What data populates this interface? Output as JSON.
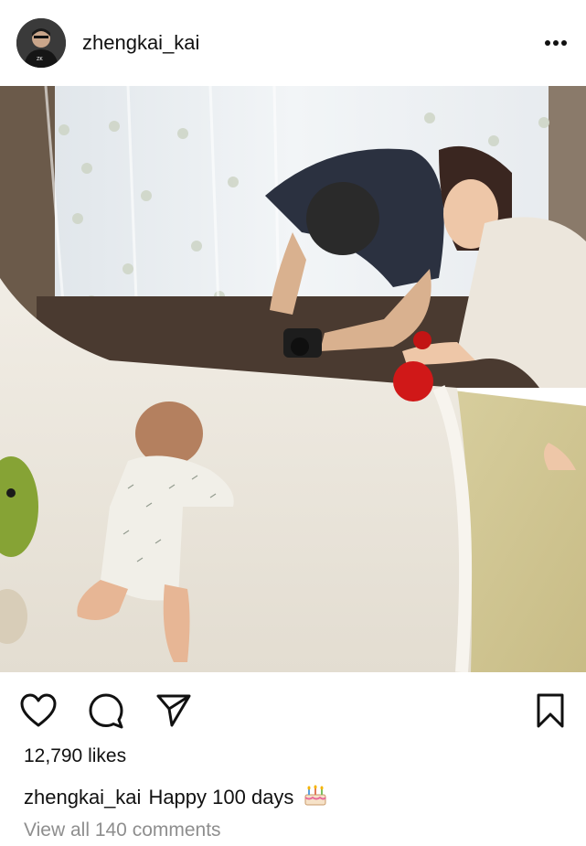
{
  "post": {
    "username": "zhengkai_kai",
    "more_icon": "more-horizontal-icon",
    "likes_text": "12,790 likes",
    "caption_username": "zhengkai_kai",
    "caption_text": "Happy 100 days",
    "caption_emoji": "birthday-cake-icon",
    "view_comments": "View all 140 comments"
  },
  "actions": [
    {
      "name": "like-button",
      "icon": "heart-icon"
    },
    {
      "name": "comment-button",
      "icon": "comment-icon"
    },
    {
      "name": "share-button",
      "icon": "send-icon"
    },
    {
      "name": "save-button",
      "icon": "bookmark-icon"
    }
  ]
}
